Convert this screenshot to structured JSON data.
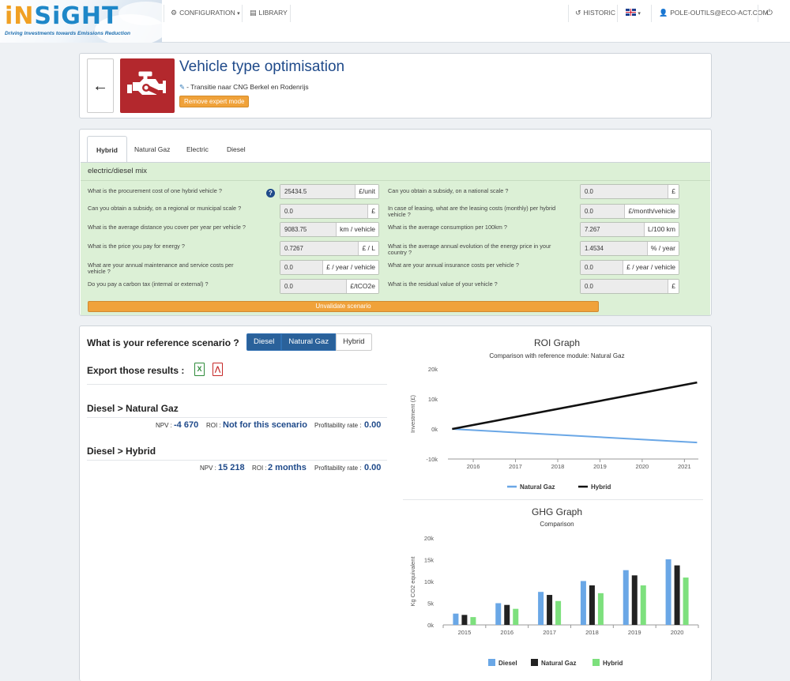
{
  "nav": {
    "logo_part1": "iN",
    "logo_part2": "SiGHT",
    "logo_tagline": "Driving Investments towards Emissions Reduction",
    "configuration": "CONFIGURATION",
    "library": "LIBRARY",
    "historic": "HISTORIC",
    "user": "POLE-OUTILS@ECO-ACT.COM"
  },
  "header": {
    "title": "Vehicle type optimisation",
    "subtitle": "- Transitie naar CNG Berkel en Rodenrijs",
    "expert_button": "Remove expert mode"
  },
  "tabs": [
    {
      "label": "Hybrid",
      "active": true
    },
    {
      "label": "Natural Gaz",
      "active": false
    },
    {
      "label": "Electric",
      "active": false
    },
    {
      "label": "Diesel",
      "active": false
    }
  ],
  "form": {
    "section_title": "electric/diesel mix",
    "left": [
      {
        "label": "What is the procurement cost of one hybrid vehicle ?",
        "value": "25434.5",
        "unit": "£/unit"
      },
      {
        "label": "Can you obtain a subsidy, on a regional or municipal scale ?",
        "value": "0.0",
        "unit": "£"
      },
      {
        "label": "What is the average distance you cover per year per vehicle ?",
        "value": "9083.75",
        "unit": "km / vehicle"
      },
      {
        "label": "What is the price you pay for energy ?",
        "value": "0.7267",
        "unit": "£ / L"
      },
      {
        "label": "What are your annual maintenance and service costs per vehicle ?",
        "value": "0.0",
        "unit": "£ / year / vehicle"
      },
      {
        "label": "Do you pay a carbon tax (internal or external) ?",
        "value": "0.0",
        "unit": "£/tCO2e"
      }
    ],
    "right": [
      {
        "label": "Can you obtain a subsidy, on a national scale ?",
        "value": "0.0",
        "unit": "£"
      },
      {
        "label": "In case of leasing, what are the leasing costs (monthly) per hybrid vehicle ?",
        "value": "0.0",
        "unit": "£/month/vehicle"
      },
      {
        "label": "What is the average consumption per 100km ?",
        "value": "7.267",
        "unit": "L/100 km"
      },
      {
        "label": "What is the average annual evolution of the energy price in your country ?",
        "value": "1.4534",
        "unit": "% / year"
      },
      {
        "label": "What are your annual insurance costs per vehicle ?",
        "value": "0.0",
        "unit": "£ / year / vehicle"
      },
      {
        "label": "What is the residual value of your vehicle ?",
        "value": "0.0",
        "unit": "£"
      }
    ],
    "unvalidate_button": "Unvalidate scenario"
  },
  "results": {
    "reference_question": "What is your reference scenario ?",
    "reference_options": [
      {
        "label": "Diesel",
        "active": true
      },
      {
        "label": "Natural Gaz",
        "active": true
      },
      {
        "label": "Hybrid",
        "active": false
      }
    ],
    "export_label": "Export those results :",
    "comparisons": [
      {
        "title": "Diesel > Natural Gaz",
        "npv_label": "NPV :",
        "npv": "-4 670",
        "roi_label": "ROI :",
        "roi": "Not for this scenario",
        "rate_label": "Profitability rate :",
        "rate": "0.00"
      },
      {
        "title": "Diesel > Hybrid",
        "npv_label": "NPV :",
        "npv": "15 218",
        "roi_label": "ROI :",
        "roi": "2 months",
        "rate_label": "Profitability rate :",
        "rate": "0.00"
      }
    ]
  },
  "chart_data": [
    {
      "type": "line",
      "title": "ROI Graph",
      "subtitle": "Comparison with reference module: Natural Gaz",
      "ylabel": "Investment (£)",
      "xlabel": "",
      "x_ticks": [
        "2016",
        "2017",
        "2018",
        "2019",
        "2020",
        "2021"
      ],
      "y_ticks": [
        "20k",
        "10k",
        "0k",
        "-10k"
      ],
      "x": [
        2015.5,
        2021.3
      ],
      "xlim": [
        2015.4,
        2021.33
      ],
      "ylim": [
        -10000,
        20000
      ],
      "series": [
        {
          "name": "Natural Gaz",
          "color": "#6aa7e6",
          "values": [
            0,
            -4500
          ]
        },
        {
          "name": "Hybrid",
          "color": "#111111",
          "values": [
            0,
            15500
          ]
        }
      ],
      "legend": "bottom"
    },
    {
      "type": "bar",
      "title": "GHG Graph",
      "subtitle": "Comparison",
      "ylabel": "Kg CO2 equivalent",
      "xlabel": "",
      "categories": [
        "2015",
        "2016",
        "2017",
        "2018",
        "2019",
        "2020"
      ],
      "y_ticks": [
        "20k",
        "15k",
        "10k",
        "5k",
        "0k"
      ],
      "ylim": [
        0,
        20000
      ],
      "series": [
        {
          "name": "Diesel",
          "color": "#6aa7e6",
          "values": [
            2600,
            5000,
            7600,
            10100,
            12600,
            15100
          ]
        },
        {
          "name": "Natural Gaz",
          "color": "#222222",
          "values": [
            2300,
            4600,
            6900,
            9100,
            11400,
            13700
          ]
        },
        {
          "name": "Hybrid",
          "color": "#7de07d",
          "values": [
            1800,
            3700,
            5500,
            7300,
            9100,
            10900
          ]
        }
      ],
      "legend": "bottom"
    }
  ]
}
